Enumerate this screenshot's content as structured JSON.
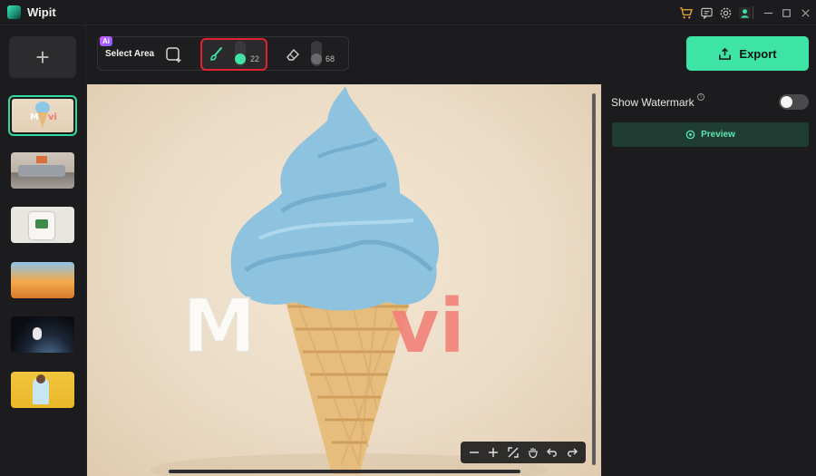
{
  "app": {
    "title": "Wipit"
  },
  "titlebar": {
    "icons": [
      "cart-icon",
      "message-icon",
      "settings-icon",
      "user-icon"
    ],
    "window_controls": [
      "minimize-icon",
      "maximize-icon",
      "close-icon"
    ]
  },
  "left_rail": {
    "add_label": "+",
    "thumbnails": [
      {
        "name": "thumbnail-ice-cream",
        "active": true
      },
      {
        "name": "thumbnail-living-room",
        "active": false
      },
      {
        "name": "thumbnail-tshirt",
        "active": false
      },
      {
        "name": "thumbnail-flowers",
        "active": false
      },
      {
        "name": "thumbnail-astronaut",
        "active": false
      },
      {
        "name": "thumbnail-girl-flowers",
        "active": false
      }
    ]
  },
  "toolbar": {
    "ai_badge": "Ai",
    "select_area_label": "Select Area",
    "brush_size": "22",
    "eraser_size": "68"
  },
  "export": {
    "label": "Export"
  },
  "canvas": {
    "watermark_text": "MoVi"
  },
  "right_panel": {
    "show_watermark_label": "Show Watermark",
    "info_glyph": "i",
    "show_watermark_on": false,
    "preview_label": "Preview"
  },
  "colors": {
    "accent": "#3ee3a6",
    "highlight_border": "#e0232e",
    "background": "#1c1c1e"
  }
}
